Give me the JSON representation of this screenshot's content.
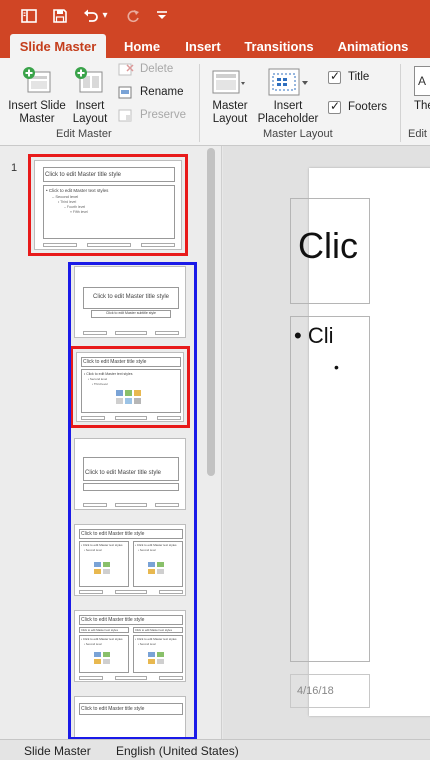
{
  "titlebar": {
    "icons": [
      "sidebar-toggle-icon",
      "save-icon",
      "undo-icon",
      "redo-icon",
      "customize-toolbar-icon"
    ],
    "undo_caret": "▾",
    "more_glyph": "▾"
  },
  "tabs": [
    {
      "label": "Slide Master",
      "active": true
    },
    {
      "label": "Home"
    },
    {
      "label": "Insert"
    },
    {
      "label": "Transitions"
    },
    {
      "label": "Animations"
    }
  ],
  "ribbon": {
    "edit_master": {
      "insert_slide_master": "Insert Slide\nMaster",
      "insert_layout": "Insert\nLayout",
      "delete": "Delete",
      "rename": "Rename",
      "preserve": "Preserve",
      "group_label": "Edit Master"
    },
    "master_layout": {
      "master_layout": "Master\nLayout",
      "insert_placeholder": "Insert\nPlaceholder",
      "title_check": "Title",
      "footers_check": "Footers",
      "group_label": "Master Layout"
    },
    "edit_theme": {
      "themes_label": "The",
      "group_label": "Edit T"
    }
  },
  "thumbnails": {
    "master_number": "1",
    "master_title": "Click to edit Master title style",
    "master_body": "• Click to edit Master text styles",
    "master_level2": "– Second level",
    "master_level3": "• Third level",
    "master_level4": "– Fourth level",
    "master_level5": "» Fifth level",
    "layout_title_text": "Click to edit Master title style",
    "layout_subtitle_text": "Click to edit Master subtitle style",
    "layout_body_text": "• Click to edit Master text styles",
    "layout_second_level": "• Second level",
    "layout_third_level": "• Third level",
    "comparison_left_head": "Click to edit Master text styles",
    "comparison_right_head": "Click to edit Master text styles"
  },
  "main_slide": {
    "title_fragment": "Clic",
    "bullet_fragment": "• Cli",
    "sub_bullet_fragment": "•",
    "date": "4/16/18"
  },
  "status": {
    "view": "Slide Master",
    "language": "English (United States)"
  },
  "colors": {
    "accent": "#d04525",
    "active_tab_text": "#c43e1c",
    "highlight_red": "#e81a1a",
    "highlight_blue": "#1a1ae8"
  }
}
